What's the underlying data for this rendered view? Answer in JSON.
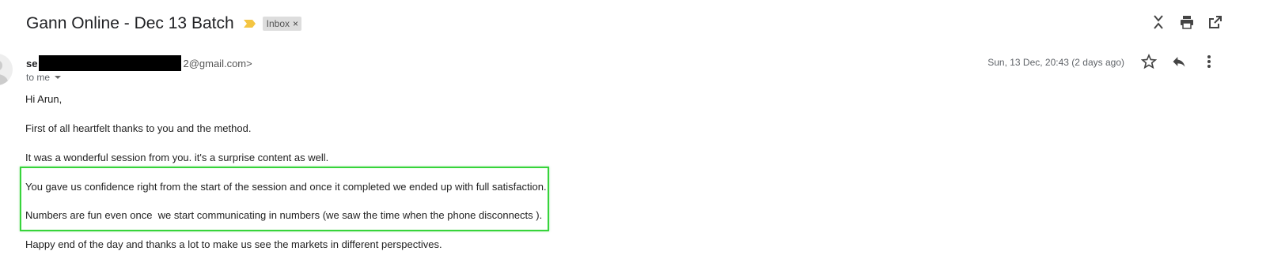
{
  "email": {
    "subject": "Gann Online - Dec 13 Batch",
    "label": "Inbox",
    "label_remove": "×",
    "sender_name_visible": "se",
    "sender_email_visible": "2@gmail.com>",
    "recipient": "to me",
    "date": "Sun, 13 Dec, 20:43 (2 days ago)",
    "body": [
      "Hi Arun,",
      "First of all heartfelt thanks to you and the method.",
      "It was a wonderful session from you. it's a surprise content as well.",
      "You gave us confidence right from the start of the session and once it completed we ended up with full satisfaction.",
      "Numbers are fun even once  we start communicating in numbers (we saw the time when the phone disconnects ).",
      "Happy end of the day and thanks a lot to make us see the markets in different perspectives."
    ]
  },
  "icons": {
    "importance": "importance-marker-icon",
    "collapse": "collapse-all-icon",
    "print": "print-icon",
    "open_new_window": "open-in-new-window-icon",
    "star": "star-icon",
    "reply": "reply-icon",
    "more": "more-vert-icon"
  },
  "colors": {
    "importance": "#f4c542",
    "highlight_border": "#37d43b",
    "label_chip_bg": "#dddddd",
    "redaction": "#000000"
  }
}
